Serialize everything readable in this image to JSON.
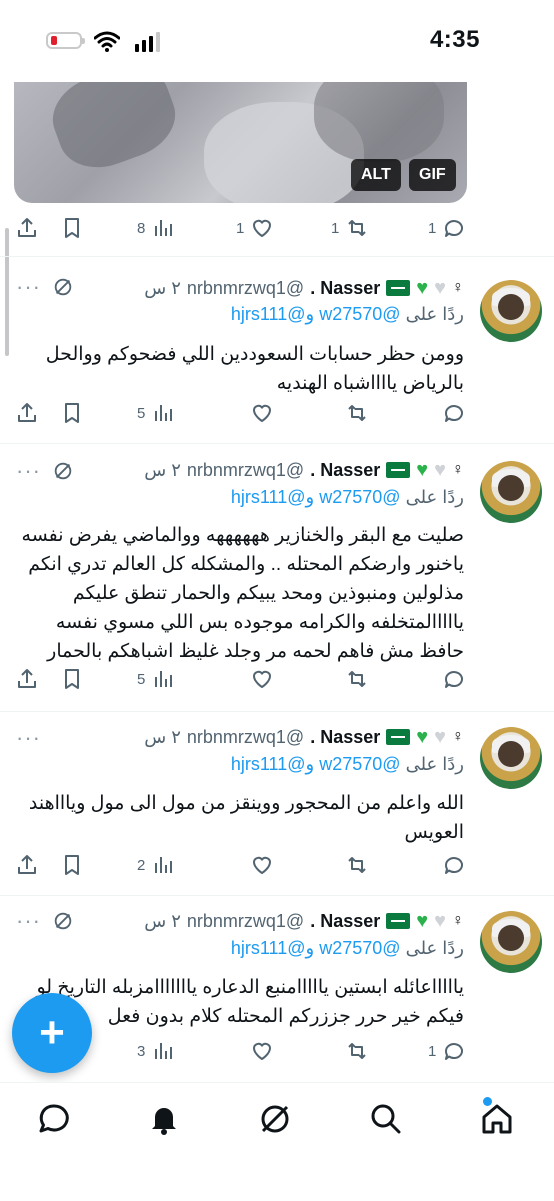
{
  "status_bar": {
    "time": "4:35"
  },
  "media": {
    "alt_label": "ALT",
    "gif_label": "GIF"
  },
  "top_actions": {
    "views": "8",
    "likes": "1",
    "retweets": "1",
    "replies": "1"
  },
  "tweets": [
    {
      "name": "Nasser .",
      "handle": "@nrbnmrzwq1",
      "time": "٢ س",
      "replying_prefix": "ردًا على",
      "replying_to": "@w27570 و@hjrs111",
      "text": "وومن حظر حسابات السعوددين اللي فضحوكم ووالحل بالرياض يااااشباه الهنديه",
      "views": "5",
      "likes": "",
      "retweets": "",
      "replies": ""
    },
    {
      "name": "Nasser .",
      "handle": "@nrbnmrzwq1",
      "time": "٢ س",
      "replying_prefix": "ردًا على",
      "replying_to": "@w27570 و@hjrs111",
      "text": "صليت مع البقر والخنازير ههههههه ووالماضي يفرض نفسه ياخنور وارضكم المحتله .. والمشكله كل العالم تدري انكم مذلولين ومنبوذين ومحد يبيكم والحمار تنطق عليكم يااااالمتخلفه والكرامه موجوده بس اللي مسوي نفسه حافظ مش فاهم لحمه مر وجلد غليظ اشباهكم بالحمار",
      "views": "5",
      "likes": "",
      "retweets": "",
      "replies": ""
    },
    {
      "name": "Nasser .",
      "handle": "@nrbnmrzwq1",
      "time": "٢ س",
      "replying_prefix": "ردًا على",
      "replying_to": "@w27570 و@hjrs111",
      "text": "الله واعلم من المحجور ووينقز من مول الى مول وياااهند العويس",
      "views": "2",
      "likes": "",
      "retweets": "",
      "replies": ""
    },
    {
      "name": "Nasser .",
      "handle": "@nrbnmrzwq1",
      "time": "٢ س",
      "replying_prefix": "ردًا على",
      "replying_to": "@w27570 و@hjrs111",
      "text": "ياااااعائله ابستين يااااامنبع الدعاره يااااااامزبله التاريخ لو فيكم خير حرر جززركم المحتله كلام بدون فعل",
      "views": "3",
      "likes": "",
      "retweets": "",
      "replies": "1"
    }
  ],
  "colors": {
    "accent": "#1d9bf0",
    "muted": "#536471",
    "green_heart": "#2bb24c"
  },
  "icons": [
    "share-icon",
    "bookmark-icon",
    "views-icon",
    "like-icon",
    "retweet-icon",
    "reply-icon",
    "grok-icon",
    "more-icon",
    "home-icon",
    "search-icon",
    "notifications-icon",
    "messages-icon",
    "compose-icon"
  ]
}
